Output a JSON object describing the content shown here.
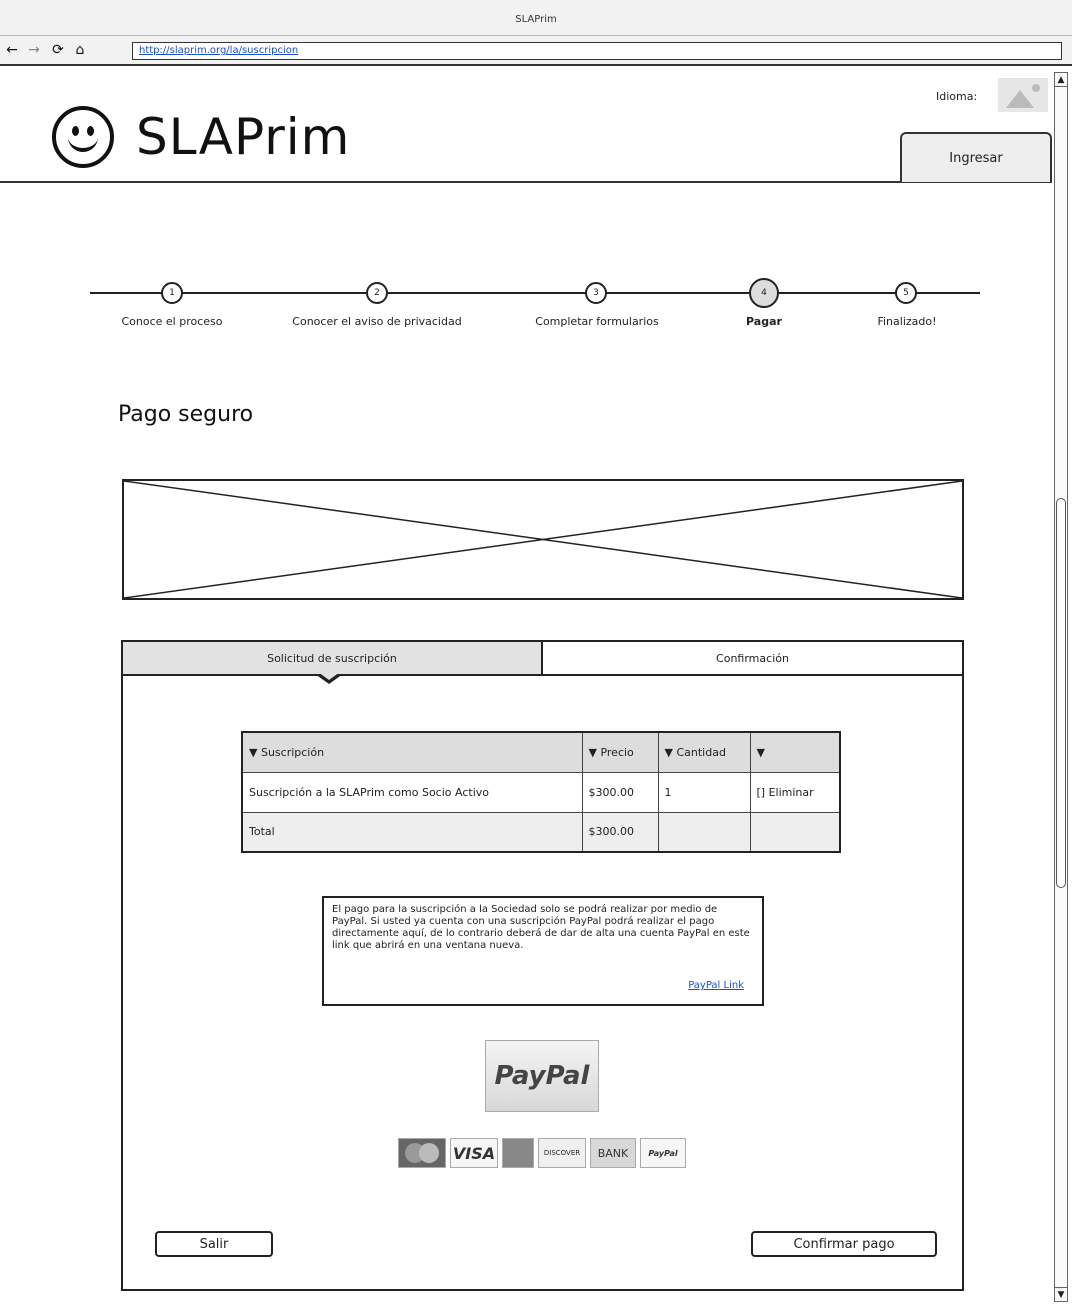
{
  "browser": {
    "title": "SLAPrim",
    "url": "http://slaprim.org/la/suscripcion"
  },
  "header": {
    "logo_text": "SLAPrim",
    "language_label": "Idioma:",
    "login_label": "Ingresar"
  },
  "steps": [
    {
      "number": "1",
      "label": "Conoce el proceso",
      "active": false
    },
    {
      "number": "2",
      "label": "Conocer el aviso de privacidad",
      "active": false
    },
    {
      "number": "3",
      "label": "Completar formularios",
      "active": false
    },
    {
      "number": "4",
      "label": "Pagar",
      "active": true
    },
    {
      "number": "5",
      "label": "Finalizado!",
      "active": false
    }
  ],
  "page_title": "Pago seguro",
  "tabs": [
    {
      "label": "Solicitud de suscripción",
      "selected": true
    },
    {
      "label": "Confirmación",
      "selected": false
    }
  ],
  "table": {
    "headers": [
      "▼ Suscripción",
      "▼ Precio",
      "▼ Cantidad",
      "▼"
    ],
    "rows": [
      [
        "Suscripción a la SLAPrim como Socio Activo",
        "$300.00",
        "1",
        "[] Eliminar"
      ]
    ],
    "total": [
      "Total",
      "$300.00",
      "",
      ""
    ]
  },
  "info": {
    "text": "El pago para la suscripción a la Sociedad solo se podrá realizar por medio de PayPal. Si usted ya cuenta con una suscripción PayPal podrá realizar el pago directamente aquí, de lo contrario deberá de dar de alta una cuenta PayPal en este link que abrirá en una ventana nueva.",
    "link": "PayPal Link"
  },
  "paypal_button": "PayPal",
  "payment_methods": [
    "MasterCard",
    "VISA",
    "American Express",
    "DISCOVER",
    "BANK",
    "PayPal"
  ],
  "buttons": {
    "exit": "Salir",
    "confirm": "Confirmar pago"
  }
}
